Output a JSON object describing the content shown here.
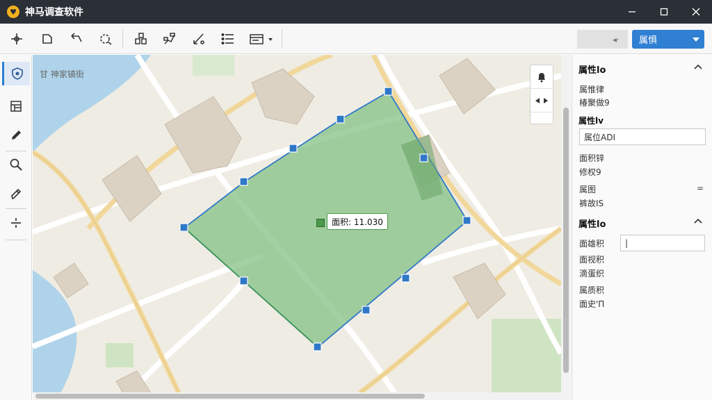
{
  "app": {
    "title": "神马调查软件",
    "logo_glyph": "♥"
  },
  "window_controls": {
    "minimize": "—",
    "maximize": "☐",
    "close": "✕"
  },
  "toolbar": {
    "tools": [
      {
        "name": "crosshair-icon"
      },
      {
        "name": "polygon-select-icon"
      },
      {
        "name": "undo-arrow-icon"
      },
      {
        "name": "rotate-icon"
      },
      {
        "name": "layers-grid-icon"
      },
      {
        "name": "route-icon"
      },
      {
        "name": "measure-icon"
      },
      {
        "name": "list-icon"
      },
      {
        "name": "table-dropdown-icon"
      }
    ],
    "grey_button_text": "◂·",
    "select_value": "属惧"
  },
  "left_tools": [
    {
      "name": "layer-shield-icon",
      "active": true
    },
    {
      "name": "table-icon"
    },
    {
      "name": "pencil-icon"
    },
    {
      "name": "zoom-icon"
    },
    {
      "name": "brush-icon"
    },
    {
      "name": "split-icon"
    }
  ],
  "map": {
    "label": "甘 神家镇街",
    "area_label": "面积: 11.030",
    "colors": {
      "polygon_fill": "#7fbf7f",
      "polygon_stroke": "#2f78c8",
      "vertex": "#2f78c8"
    }
  },
  "map_controls": {
    "bell": "🔔",
    "pan": "◂▸"
  },
  "panel": {
    "section1": {
      "title": "属性lo",
      "rows": [
        "属惟律",
        "椿聚做9"
      ],
      "sub_title": "属性lv",
      "input_value": "属位ADI",
      "rows2": [
        "面积锌",
        "修权9"
      ],
      "row3_label": "属图",
      "row3_eq": "=",
      "row4": "裤故IS"
    },
    "section2": {
      "title": "属性lo",
      "field_label": "面雄积",
      "field_value": "|",
      "rows": [
        "面视积",
        "滴蛋织",
        "属质积",
        "面史'Π"
      ]
    }
  }
}
